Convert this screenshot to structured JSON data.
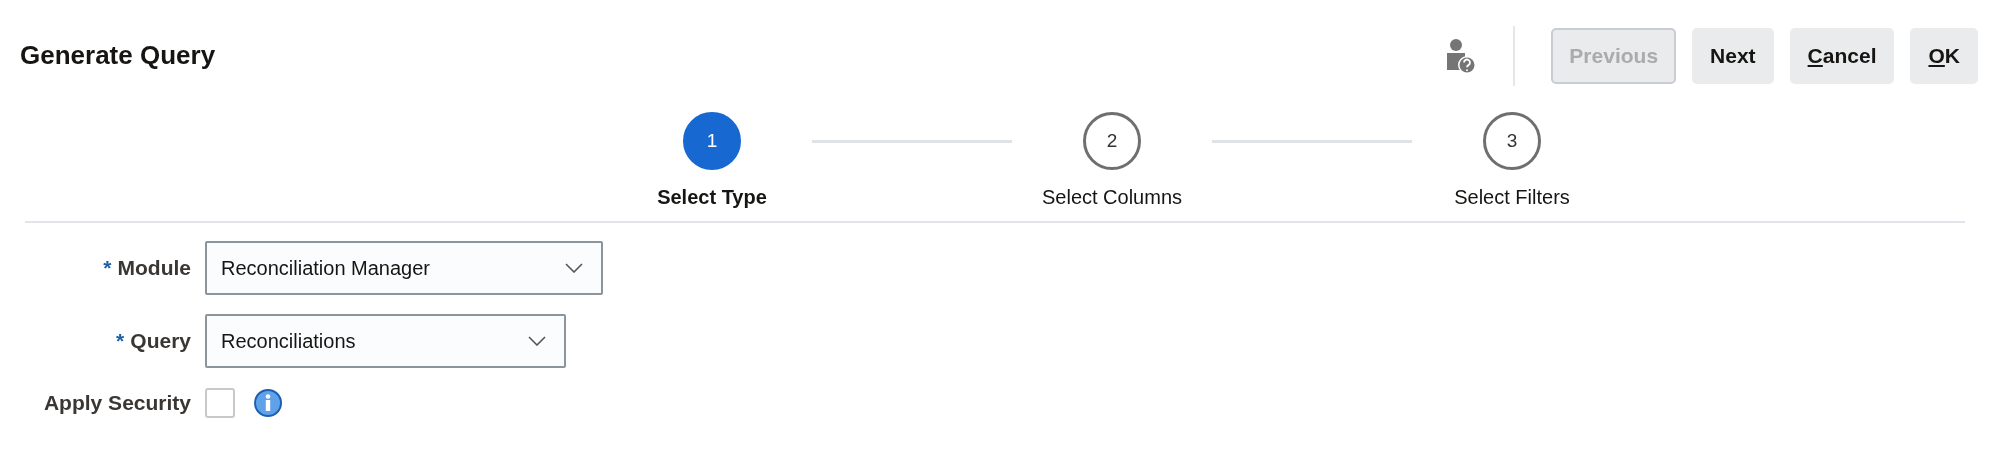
{
  "title": "Generate Query",
  "buttons": [
    {
      "label": "Previous",
      "disabled": true,
      "underline_first": false
    },
    {
      "label": "Next",
      "disabled": false,
      "underline_first": false
    },
    {
      "label": "Cancel",
      "disabled": false,
      "underline_first": true
    },
    {
      "label": "OK",
      "disabled": false,
      "underline_first": true
    }
  ],
  "steps": [
    {
      "number": "1",
      "label": "Select Type",
      "selected": true
    },
    {
      "number": "2",
      "label": "Select Columns",
      "selected": false
    },
    {
      "number": "3",
      "label": "Select Filters",
      "selected": false
    }
  ],
  "fields": [
    {
      "kind": "select",
      "label": "Module",
      "required_mark": "*",
      "value": "Reconciliation Manager"
    },
    {
      "kind": "select",
      "label": "Query",
      "required_mark": "*",
      "value": "Reconciliations"
    },
    {
      "kind": "checkbox",
      "label": "Apply Security",
      "checked": false
    }
  ]
}
